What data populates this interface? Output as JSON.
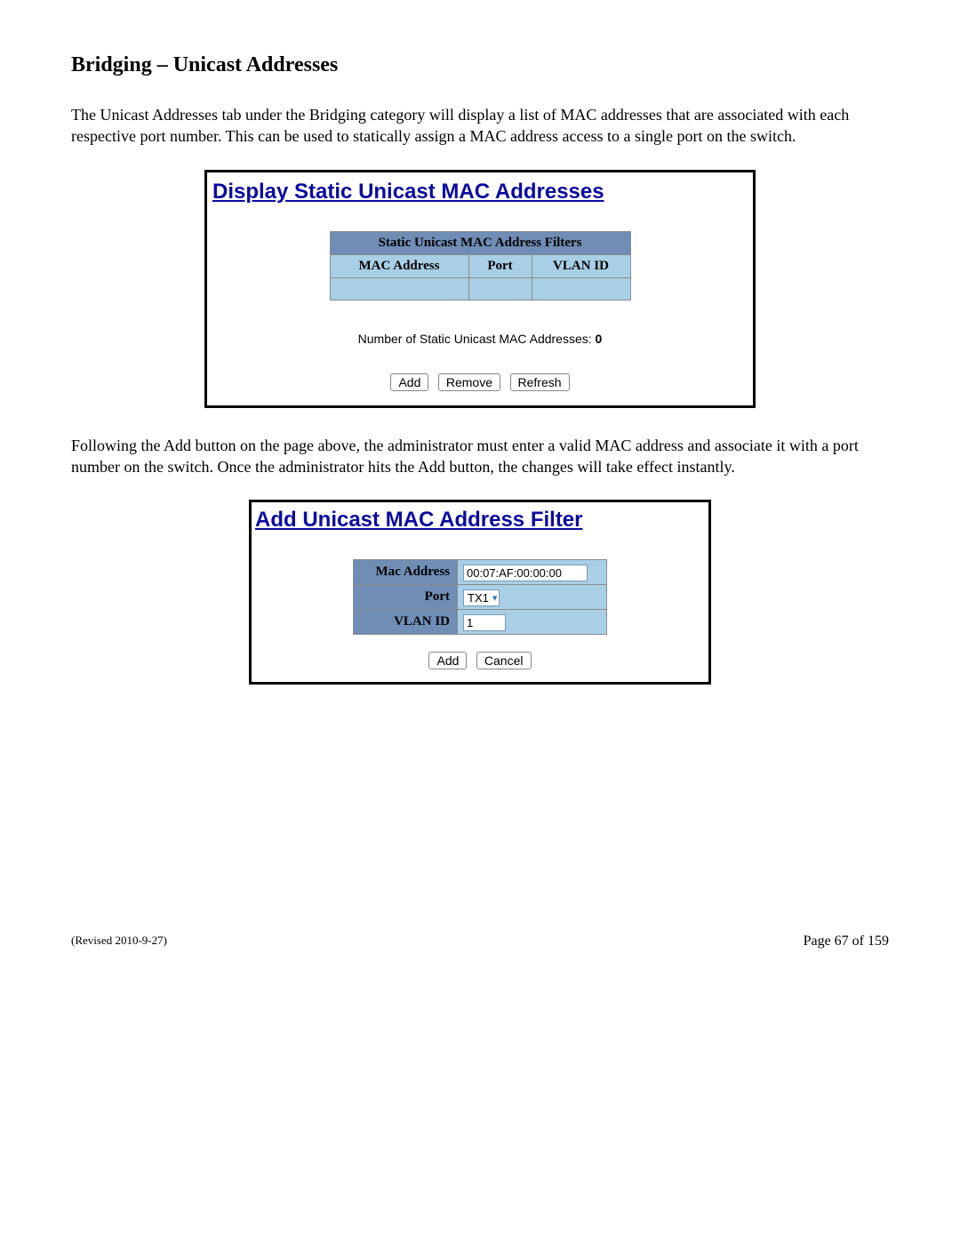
{
  "heading": "Bridging – Unicast Addresses",
  "paragraph1": "The Unicast Addresses tab under the Bridging category will display a list of MAC addresses that are associated with each respective port number.  This can be used to statically assign a MAC address access to a single port on the switch.",
  "panel1": {
    "title": "Display Static Unicast MAC Addresses",
    "table_caption": "Static Unicast MAC Address Filters",
    "col_mac": "MAC Address",
    "col_port": "Port",
    "col_vlan": "VLAN ID",
    "count_label": "Number of Static Unicast MAC Addresses: ",
    "count_value": "0",
    "btn_add": "Add",
    "btn_remove": "Remove",
    "btn_refresh": "Refresh"
  },
  "paragraph2": "Following the Add button on the page above, the administrator must enter a valid MAC address and associate it with a port number on the switch.  Once the administrator hits the Add button, the changes will take effect instantly.",
  "panel2": {
    "title": "Add Unicast MAC Address Filter",
    "row_mac_label": "Mac Address",
    "row_mac_value": "00:07:AF:00:00:00",
    "row_port_label": "Port",
    "row_port_value": "TX1",
    "row_vlan_label": "VLAN ID",
    "row_vlan_value": "1",
    "btn_add": "Add",
    "btn_cancel": "Cancel"
  },
  "footer": {
    "revised": "(Revised 2010-9-27)",
    "page": "Page 67 of 159"
  }
}
